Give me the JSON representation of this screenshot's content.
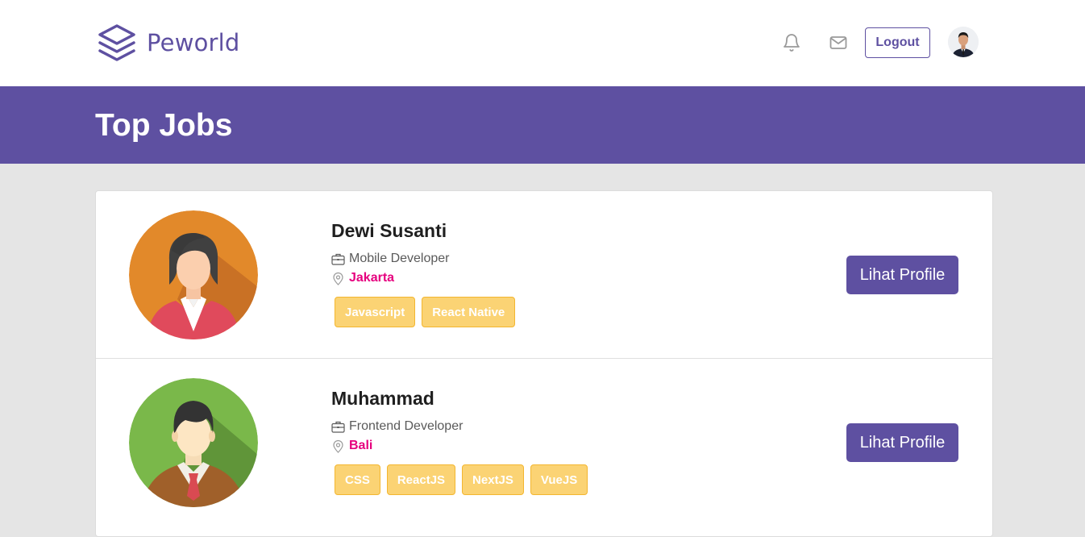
{
  "brand": {
    "name": "Peworld",
    "logo_icon": "layers-icon",
    "color": "#5e50a1"
  },
  "nav": {
    "notification_icon": "bell-icon",
    "mail_icon": "mail-icon",
    "logout_label": "Logout",
    "avatar_icon": "user-avatar"
  },
  "banner": {
    "title": "Top Jobs",
    "background": "#5e50a1"
  },
  "candidates": [
    {
      "name": "Dewi Susanti",
      "job": "Mobile Developer",
      "location": "Jakarta",
      "skills": [
        "Javascript",
        "React Native"
      ],
      "button_label": "Lihat Profile",
      "avatar_icon": "female-avatar"
    },
    {
      "name": "Muhammad",
      "job": "Frontend Developer",
      "location": "Bali",
      "skills": [
        "CSS",
        "ReactJS",
        "NextJS",
        "VueJS"
      ],
      "button_label": "Lihat Profile",
      "avatar_icon": "male-avatar"
    }
  ],
  "colors": {
    "accent": "#5e50a1",
    "location": "#e6007e",
    "skill_bg": "#fbd374",
    "skill_border": "#f3b630",
    "page_bg": "#e5e5e5"
  }
}
